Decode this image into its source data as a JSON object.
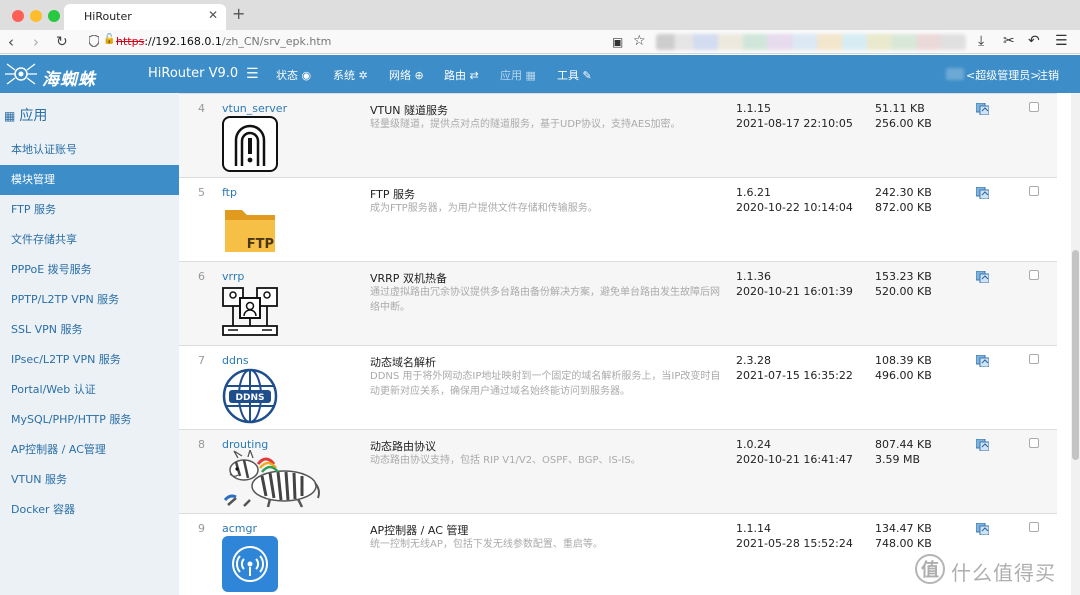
{
  "browser": {
    "tab_title": "HiRouter",
    "url_scheme": "https",
    "url_host": "://192.168.0.1",
    "url_path": "/zh_CN/srv_epk.htm"
  },
  "header": {
    "logo_text": "海蜘蛛",
    "brand": "HiRouter V9.0",
    "menu": [
      {
        "label": "状态 ◉"
      },
      {
        "label": "系统 ✲"
      },
      {
        "label": "网络 ⊕"
      },
      {
        "label": "路由 ⇄"
      },
      {
        "label": "应用 ▦"
      },
      {
        "label": "工具 ✎"
      }
    ],
    "user_label": "<超级管理员>",
    "logout": "注销"
  },
  "sidebar": {
    "title": "应用",
    "items": [
      {
        "label": "本地认证账号"
      },
      {
        "label": "模块管理"
      },
      {
        "label": "FTP 服务"
      },
      {
        "label": "文件存储共享"
      },
      {
        "label": "PPPoE 拨号服务"
      },
      {
        "label": "PPTP/L2TP VPN 服务"
      },
      {
        "label": "SSL VPN 服务"
      },
      {
        "label": "IPsec/L2TP VPN 服务"
      },
      {
        "label": "Portal/Web 认证"
      },
      {
        "label": "MySQL/PHP/HTTP 服务"
      },
      {
        "label": "AP控制器 / AC管理"
      },
      {
        "label": "VTUN 服务"
      },
      {
        "label": "Docker 容器"
      }
    ],
    "active_index": 1
  },
  "modules": [
    {
      "num": "4",
      "name": "vtun_server",
      "title": "VTUN 隧道服务",
      "desc": "轻量级隧道，提供点对点的隧道服务，基于UDP协议，支持AES加密。",
      "version": "1.1.15",
      "date": "2021-08-17 22:10:05",
      "size1": "51.11 KB",
      "size2": "256.00 KB",
      "icon": "vtun-icon"
    },
    {
      "num": "5",
      "name": "ftp",
      "title": "FTP 服务",
      "desc": "成为FTP服务器，为用户提供文件存储和传输服务。",
      "version": "1.6.21",
      "date": "2020-10-22 10:14:04",
      "size1": "242.30 KB",
      "size2": "872.00 KB",
      "icon": "ftp-folder-icon",
      "icon_text": "FTP"
    },
    {
      "num": "6",
      "name": "vrrp",
      "title": "VRRP 双机热备",
      "desc": "通过虚拟路由冗余协议提供多台路由备份解决方案，避免单台路由发生故障后网络中断。",
      "version": "1.1.36",
      "date": "2020-10-21 16:01:39",
      "size1": "153.23 KB",
      "size2": "520.00 KB",
      "icon": "vrrp-icon"
    },
    {
      "num": "7",
      "name": "ddns",
      "title": "动态域名解析",
      "desc": "DDNS 用于将外网动态IP地址映射到一个固定的域名解析服务上，当IP改变时自动更新对应关系，确保用户通过域名始终能访问到服务器。",
      "version": "2.3.28",
      "date": "2021-07-15 16:35:22",
      "size1": "108.39 KB",
      "size2": "496.00 KB",
      "icon": "ddns-globe-icon",
      "icon_text": "DDNS"
    },
    {
      "num": "8",
      "name": "drouting",
      "title": "动态路由协议",
      "desc": "动态路由协议支持，包括 RIP V1/V2、OSPF、BGP、IS-IS。",
      "version": "1.0.24",
      "date": "2020-10-21 16:41:47",
      "size1": "807.44 KB",
      "size2": "3.59 MB",
      "icon": "zebra-icon"
    },
    {
      "num": "9",
      "name": "acmgr",
      "title": "AP控制器 / AC 管理",
      "desc": "统一控制无线AP，包括下发无线参数配置、重启等。",
      "version": "1.1.14",
      "date": "2021-05-28 15:52:24",
      "size1": "134.47 KB",
      "size2": "748.00 KB",
      "icon": "wireless-ap-icon"
    }
  ],
  "watermark": {
    "text": "什么值得买",
    "glyph": "值"
  },
  "colors": {
    "accent": "#3c8dc8",
    "sidebar_bg": "#ecf1f6",
    "link": "#2a7ab8"
  }
}
